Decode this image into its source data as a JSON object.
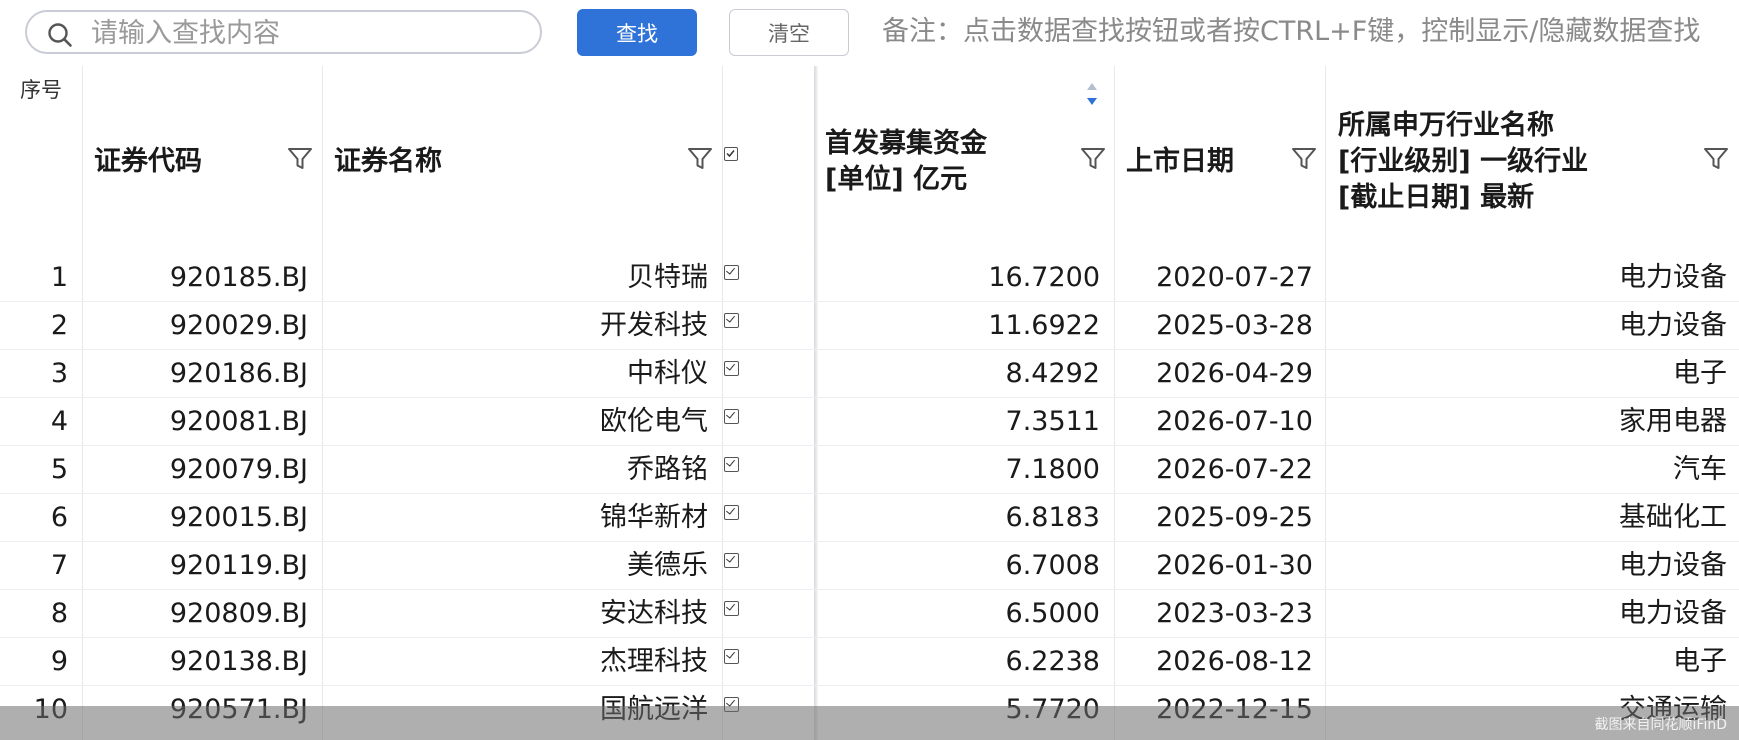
{
  "search": {
    "placeholder": "请输入查找内容",
    "find_label": "查找",
    "clear_label": "清空",
    "note": "备注：点击数据查找按钮或者按CTRL+F键，控制显示/隐藏数据查找"
  },
  "table": {
    "headers": {
      "index": "序号",
      "code": "证券代码",
      "name": "证券名称",
      "raised_line1": "首发募集资金",
      "raised_line2": "[单位]  亿元",
      "list_date": "上市日期",
      "industry_line1": "所属申万行业名称",
      "industry_line2": "[行业级别]  一级行业",
      "industry_line3": "[截止日期]  最新"
    },
    "sort_column": "首发募集资金",
    "sort_direction": "desc",
    "rows": [
      {
        "index": "1",
        "code": "920185.BJ",
        "name": "贝特瑞",
        "raised": "16.7200",
        "date": "2020-07-27",
        "industry": "电力设备"
      },
      {
        "index": "2",
        "code": "920029.BJ",
        "name": "开发科技",
        "raised": "11.6922",
        "date": "2025-03-28",
        "industry": "电力设备"
      },
      {
        "index": "3",
        "code": "920186.BJ",
        "name": "中科仪",
        "raised": "8.4292",
        "date": "2026-04-29",
        "industry": "电子"
      },
      {
        "index": "4",
        "code": "920081.BJ",
        "name": "欧伦电气",
        "raised": "7.3511",
        "date": "2026-07-10",
        "industry": "家用电器"
      },
      {
        "index": "5",
        "code": "920079.BJ",
        "name": "乔路铭",
        "raised": "7.1800",
        "date": "2026-07-22",
        "industry": "汽车"
      },
      {
        "index": "6",
        "code": "920015.BJ",
        "name": "锦华新材",
        "raised": "6.8183",
        "date": "2025-09-25",
        "industry": "基础化工"
      },
      {
        "index": "7",
        "code": "920119.BJ",
        "name": "美德乐",
        "raised": "6.7008",
        "date": "2026-01-30",
        "industry": "电力设备"
      },
      {
        "index": "8",
        "code": "920809.BJ",
        "name": "安达科技",
        "raised": "6.5000",
        "date": "2023-03-23",
        "industry": "电力设备"
      },
      {
        "index": "9",
        "code": "920138.BJ",
        "name": "杰理科技",
        "raised": "6.2238",
        "date": "2026-08-12",
        "industry": "电子"
      },
      {
        "index": "10",
        "code": "920571.BJ",
        "name": "国航远洋",
        "raised": "5.7720",
        "date": "2022-12-15",
        "industry": "交通运输"
      }
    ]
  },
  "footer": {
    "watermark": "截图来自同花顺iFinD"
  },
  "colors": {
    "accent": "#2f73d8",
    "sort_active": "#2f73d8",
    "sort_inactive": "#b5bfd0"
  },
  "icons": [
    "search-icon",
    "filter-icon",
    "sort-icon",
    "checkbox-icon"
  ]
}
